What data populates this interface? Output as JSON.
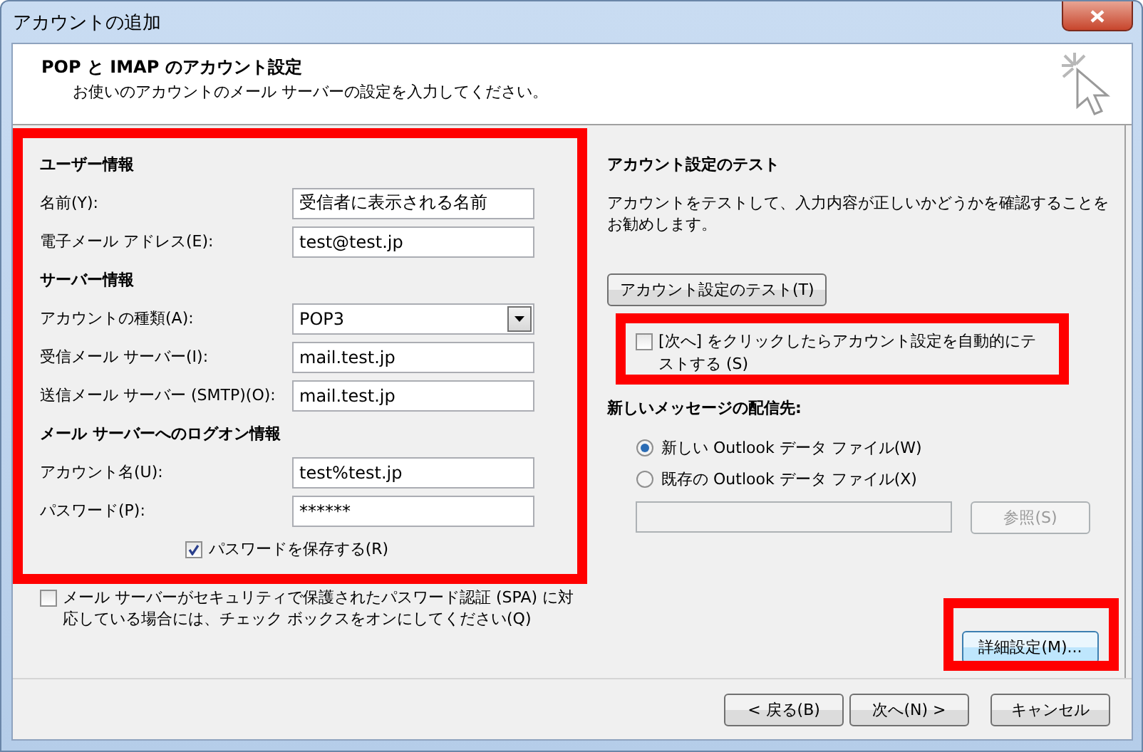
{
  "window": {
    "title": "アカウントの追加"
  },
  "header": {
    "title": "POP と IMAP のアカウント設定",
    "subtitle": "お使いのアカウントのメール サーバーの設定を入力してください。"
  },
  "sections": [
    {
      "heading": "ユーザー情報",
      "fields": [
        {
          "label": "名前(Y):",
          "value": "受信者に表示される名前",
          "kind": "text"
        },
        {
          "label": "電子メール アドレス(E):",
          "value": "test@test.jp",
          "kind": "text"
        }
      ]
    },
    {
      "heading": "サーバー情報",
      "fields": [
        {
          "label": "アカウントの種類(A):",
          "value": "POP3",
          "kind": "dropdown"
        },
        {
          "label": "受信メール サーバー(I):",
          "value": "mail.test.jp",
          "kind": "text"
        },
        {
          "label": "送信メール サーバー (SMTP)(O):",
          "value": "mail.test.jp",
          "kind": "text"
        }
      ]
    },
    {
      "heading": "メール サーバーへのログオン情報",
      "fields": [
        {
          "label": "アカウント名(U):",
          "value": "test%test.jp",
          "kind": "text"
        },
        {
          "label": "パスワード(P):",
          "value": "******",
          "kind": "text"
        }
      ]
    }
  ],
  "save_password": {
    "label": "パスワードを保存する(R)",
    "checked": true
  },
  "spa": {
    "label": "メール サーバーがセキュリティで保護されたパスワード認証 (SPA) に対応している場合には、チェック ボックスをオンにしてください(Q)",
    "checked": false
  },
  "test": {
    "heading": "アカウント設定のテスト",
    "description": "アカウントをテストして、入力内容が正しいかどうかを確認することをお勧めします。",
    "button": "アカウント設定のテスト(T)",
    "auto_test": {
      "label": "[次へ] をクリックしたらアカウント設定を自動的にテストする (S)",
      "checked": false
    }
  },
  "delivery": {
    "heading": "新しいメッセージの配信先:",
    "options": [
      {
        "label": "新しい Outlook データ ファイル(W)",
        "selected": true
      },
      {
        "label": "既存の Outlook データ ファイル(X)",
        "selected": false
      }
    ],
    "path_field": {
      "disabled": true
    },
    "browse_button": {
      "label": "参照(S)",
      "disabled": true
    }
  },
  "more_settings_button": "詳細設定(M)...",
  "footer_buttons": [
    {
      "label": "< 戻る(B)"
    },
    {
      "label": "次へ(N) >"
    },
    {
      "label": "キャンセル"
    }
  ]
}
